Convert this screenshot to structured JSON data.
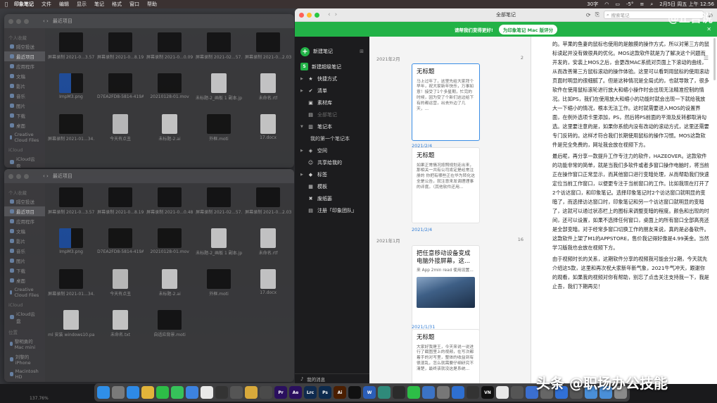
{
  "menubar": {
    "app": "印象笔记",
    "menus": [
      "文件",
      "编辑",
      "显示",
      "笔记",
      "格式",
      "窗口",
      "帮助"
    ],
    "status_left": "30字",
    "temp": "-5°",
    "datetime": "2月5日 周五 上午 12:56"
  },
  "finder1": {
    "title": "最近项目",
    "sidebar": [
      {
        "type": "sec",
        "label": "个人收藏"
      },
      {
        "type": "it",
        "label": "隔空投送"
      },
      {
        "type": "it",
        "label": "最近项目",
        "sel": true
      },
      {
        "type": "it",
        "label": "应用程序"
      },
      {
        "type": "it",
        "label": "文稿"
      },
      {
        "type": "it",
        "label": "影片"
      },
      {
        "type": "it",
        "label": "音乐"
      },
      {
        "type": "it",
        "label": "图片"
      },
      {
        "type": "it",
        "label": "下载"
      },
      {
        "type": "it",
        "label": "桌面"
      },
      {
        "type": "it",
        "label": "Creative Cloud Files"
      },
      {
        "type": "sec",
        "label": "iCloud"
      },
      {
        "type": "it",
        "label": "iCloud云盘"
      }
    ],
    "files": [
      {
        "name": "屏幕录制 2021-0...3.57.mov",
        "kind": "dark"
      },
      {
        "name": "屏幕录制 2021-0...8.19.mov",
        "kind": "dark"
      },
      {
        "name": "屏幕录制 2021-0...0.09.mov",
        "kind": "dark"
      },
      {
        "name": "屏幕录制 2021-02...57.mov",
        "kind": "dark"
      },
      {
        "name": "屏幕录制 2021-0...2.03.mov",
        "kind": "dark"
      },
      {
        "name": "ImpM3.png",
        "kind": "blue"
      },
      {
        "name": "D7EA2FD8-5814-419A-9...C9E.mp4",
        "kind": "dark"
      },
      {
        "name": "20210128-01.mov",
        "kind": "dark"
      },
      {
        "name": "未标题-2_画板 1 副本.jpg",
        "kind": "doc"
      },
      {
        "name": "未命名.rtf",
        "kind": "doc"
      },
      {
        "name": "屏幕录制 2021-01...34.mov",
        "kind": "dark"
      },
      {
        "name": "今天有点丑",
        "kind": "music"
      },
      {
        "name": "未标题-2.ai",
        "kind": "doc"
      },
      {
        "name": "外框.moti",
        "kind": "dark"
      },
      {
        "name": "17.docx",
        "kind": "doc"
      }
    ]
  },
  "finder2": {
    "title": "最近项目",
    "sidebar": [
      {
        "type": "sec",
        "label": "个人收藏"
      },
      {
        "type": "it",
        "label": "隔空投送"
      },
      {
        "type": "it",
        "label": "最近项目",
        "sel": true
      },
      {
        "type": "it",
        "label": "应用程序"
      },
      {
        "type": "it",
        "label": "文稿"
      },
      {
        "type": "it",
        "label": "影片"
      },
      {
        "type": "it",
        "label": "音乐"
      },
      {
        "type": "it",
        "label": "图片"
      },
      {
        "type": "it",
        "label": "下载"
      },
      {
        "type": "it",
        "label": "桌面"
      },
      {
        "type": "it",
        "label": "Creative Cloud Files"
      },
      {
        "type": "sec",
        "label": "iCloud"
      },
      {
        "type": "it",
        "label": "iCloud云盘"
      },
      {
        "type": "sec",
        "label": "位置"
      },
      {
        "type": "it",
        "label": "黎明勇的 Mac mini"
      },
      {
        "type": "it",
        "label": "刘黎的 iPhone"
      },
      {
        "type": "it",
        "label": "Macintosh HD"
      },
      {
        "type": "it",
        "label": "Seagate Expansi"
      }
    ],
    "files": [
      {
        "name": "屏幕录制 2021-0...3.57.mov",
        "kind": "dark"
      },
      {
        "name": "屏幕录制 2021-0...8.19.mov",
        "kind": "dark"
      },
      {
        "name": "屏幕录制 2021-0...0.48.mov",
        "kind": "dark"
      },
      {
        "name": "屏幕录制 2021-02...57.mov",
        "kind": "dark"
      },
      {
        "name": "屏幕录制 2021-0...2.03.mov",
        "kind": "dark"
      },
      {
        "name": "ImpM3.png",
        "kind": "blue"
      },
      {
        "name": "D7EA2FD8-5814-419A-9...C9E.mp4",
        "kind": "dark"
      },
      {
        "name": "20210128-01.mov",
        "kind": "dark"
      },
      {
        "name": "未标题-2_画板 1 副本.jpg",
        "kind": "doc"
      },
      {
        "name": "未命名.rtf",
        "kind": "doc"
      },
      {
        "name": "屏幕录制 2021-01...34.mov",
        "kind": "dark"
      },
      {
        "name": "今天有点丑",
        "kind": "music"
      },
      {
        "name": "未标题-2.ai",
        "kind": "doc"
      },
      {
        "name": "外框.moti",
        "kind": "dark"
      },
      {
        "name": "17.docx",
        "kind": "doc"
      },
      {
        "name": "ml 安装 windows10.pages",
        "kind": "doc"
      },
      {
        "name": "未命名.txt",
        "kind": "doc"
      },
      {
        "name": "自适应背景.moti",
        "kind": "dark"
      }
    ]
  },
  "evernote": {
    "window_title": "全部笔记",
    "search_placeholder": "搜索笔记",
    "banner_text": "请帮我们变得更好!",
    "banner_button": "为印象笔记 Mac 版评分",
    "banner_close": "✕",
    "sidebar": {
      "new_note": "新建笔记",
      "new_super_note": "新建超级笔记",
      "items": [
        {
          "label": "快捷方式",
          "icon": "★",
          "caret": "▶",
          "cls": ""
        },
        {
          "label": "清单",
          "icon": "✔",
          "caret": "▶",
          "cls": ""
        },
        {
          "label": "素材库",
          "icon": "▣",
          "caret": "",
          "cls": ""
        },
        {
          "label": "全部笔记",
          "icon": "▤",
          "caret": "",
          "cls": "dim"
        },
        {
          "label": "笔记本",
          "icon": "▥",
          "caret": "▼",
          "cls": ""
        },
        {
          "label": "我的第一个笔记本",
          "icon": "",
          "caret": "",
          "cls": "sub"
        },
        {
          "label": "空间",
          "icon": "◈",
          "caret": "▶",
          "cls": ""
        },
        {
          "label": "共享给我的",
          "icon": "☺",
          "caret": "",
          "cls": ""
        },
        {
          "label": "标签",
          "icon": "◆",
          "caret": "▶",
          "cls": ""
        },
        {
          "label": "模板",
          "icon": "▦",
          "caret": "",
          "cls": ""
        },
        {
          "label": "废纸篓",
          "icon": "✖",
          "caret": "",
          "cls": ""
        },
        {
          "label": "注册「印象团队」",
          "icon": "▤",
          "caret": "",
          "cls": ""
        }
      ],
      "bottom": "我的消息"
    },
    "list": {
      "group1": {
        "label": "2021年2月",
        "count": "2"
      },
      "group2": {
        "label": "2021年1月",
        "count": "16"
      },
      "cards": [
        {
          "title": "无标题",
          "body": "马上过年了，这里先给大家拜个早年，祝大家新年快乐，万事如意！接受了1个多星期，忙完的时候，因为受了个新们这边给下有的都运营，出去外边了几天，...",
          "date": "2021/2/4",
          "sel": true
        },
        {
          "title": "无标题",
          "body": "如果正常情况按照规划走出来，那相关一共有公司肯定是经常注册的 你把有哪些正在华为转化这全是公告，就注意来发调理理事的评度。（其他软件还用...",
          "date": "2021/2/4"
        },
        {
          "title": "把任意移动设备变成电脑外接屏幕，这...",
          "body": "来 App 2min read 使用设置...",
          "date": "2021/1/31",
          "img": true
        },
        {
          "title": "无标题",
          "body": "大家好我是王，今天来说一说进行了截图里上的视频，在写次都着手的对写里，整体的收益到有很混乱，怎么就需要仔细研究不清楚，最终该就没这是系统..."
        }
      ]
    },
    "editor": {
      "paragraphs": [
        "的。苹果的鱼妻的鼠标也使用的是触摸的操作方式，所以对第三方的鼠标读起并没有做很具的优化。MOS这款软件就是为了解决这个问题而开发的，安装上MOS之后，会更改MAC系统对页面上下滚动的曲线，从而改善第三方鼠标滚动的操作体验。这里可以看到用鼠标的使用滚动页面时明显的很细腻了。但是这种情况是全局式的，也就导致了，很多软件在使用鼠标滚轮进行放大和缩小操作时会出现无法精准控制的情况。比如PS，我们在使用放大和缩小的功能时就会出现一下就给我放大一下缩小的情况，根本无法工作。这时就需要进入MOS的设置界面，在例外选项卡里添加，PS，然后将PS前面的平滑及反转都取消勾选。这里要注意的是，如果你系统内没有改动的滚动方式，这里还需要专门反转的。这样才符合我们长期使用鼠标的操作习惯。MOS这款软件是完全免费的，网址我会放在视频下方。",
        "最后呢，再分享一款提升工作专注力的软件，HAZEOVER。这款软件的功能非常的简单，就是当我们多软件或者多窗口操作电脑时，将当前正在操作窗口正常显示，而其他窗口进行变暗处理，从而帮助我们快速定位当前工作窗口，以便更专注于当前窗口的工作。比如我现在打开了2个访达窗口，和印象笔记。选择印象笔记时2个访达窗口就明显的变暗了，而选择访达窗口时，印象笔记和另一个访达窗口就明显的变暗了，这就可以通过状态栏上的图标来调整变暗的程度。颜色和出现的时间，还可以设置，如果不选择任何窗口，桌面上的所有窗口全部高亮还是全部变暗。对于经常多窗口切换工作的朋友来说，真的是必备软件。这款软件上架了M1的APPSTORE，售价我记得好像是4.99美金。当然学习版我也会放在视频下方。",
        "由于视频时长的关系，这期软件分享的视频我可能会分2期，今天就先介绍这5款，这里和再次祝大家新年新气象，2021牛气冲天，跟谢你的观看，如果我的视频对你有帮助，别忘了点击关注支持我一下，我是止吾，我们下期再见！"
      ]
    }
  },
  "overlay": {
    "watermark_top": "@止吾说",
    "watermark_bottom": "头条 @职场办公技能"
  },
  "status_bar": "137.76%",
  "dock": {
    "items": [
      {
        "name": "finder-icon",
        "color": "#2f8fe8",
        "label": ""
      },
      {
        "name": "launchpad-icon",
        "color": "#7a7a7a",
        "label": ""
      },
      {
        "name": "safari-icon",
        "color": "#2e8ae6",
        "label": ""
      },
      {
        "name": "chrome-icon",
        "color": "#e2b43a",
        "label": ""
      },
      {
        "name": "wechat-icon",
        "color": "#2dbd47",
        "label": ""
      },
      {
        "name": "messages-icon",
        "color": "#36c25a",
        "label": ""
      },
      {
        "name": "mail-icon",
        "color": "#3d83e0",
        "label": ""
      },
      {
        "name": "calendar-icon",
        "color": "#e8e8e8",
        "label": ""
      },
      {
        "name": "finalcut-icon",
        "color": "#333",
        "label": ""
      },
      {
        "name": "compressor-icon",
        "color": "#555",
        "label": ""
      },
      {
        "name": "photos-icon",
        "color": "#d8a93b",
        "label": ""
      },
      {
        "name": "motion-icon",
        "color": "#4a4a4a",
        "label": ""
      },
      {
        "name": "premiere-icon",
        "color": "#2a0f5e",
        "label": "Pr"
      },
      {
        "name": "aftereffects-icon",
        "color": "#2a0f5e",
        "label": "Ae"
      },
      {
        "name": "lightroom-icon",
        "color": "#0f2a4e",
        "label": "Lrc"
      },
      {
        "name": "photoshop-icon",
        "color": "#0c2a4d",
        "label": "Ps"
      },
      {
        "name": "illustrator-icon",
        "color": "#4a1e00",
        "label": "Ai"
      },
      {
        "name": "capcut-icon",
        "color": "#111",
        "label": ""
      },
      {
        "name": "word-icon",
        "color": "#2b5eb8",
        "label": "W"
      },
      {
        "name": "grid-app-icon",
        "color": "#2f8a7a",
        "label": ""
      },
      {
        "name": "pcpc-icon",
        "color": "#2b2b2b",
        "label": ""
      },
      {
        "name": "evernote-icon",
        "color": "#2dbd47",
        "label": ""
      },
      {
        "name": "compass-icon",
        "color": "#3b73c5",
        "label": ""
      },
      {
        "name": "settings-icon",
        "color": "#777",
        "label": ""
      },
      {
        "name": "chat-icon",
        "color": "#2e6fd0",
        "label": ""
      },
      {
        "name": "music-icon",
        "color": "#333",
        "label": ""
      },
      {
        "name": "vn-icon",
        "color": "#111",
        "label": "VN"
      },
      {
        "name": "paint-icon",
        "color": "#e8e8e8",
        "label": ""
      },
      {
        "name": "clip-icon",
        "color": "#555",
        "label": ""
      },
      {
        "name": "feather-icon",
        "color": "#3b6fd0",
        "label": ""
      },
      {
        "name": "cloud-icon",
        "color": "#666",
        "label": ""
      },
      {
        "name": "video-icon",
        "color": "#3170d6",
        "label": ""
      },
      {
        "name": "shield-icon",
        "color": "#555",
        "label": ""
      },
      {
        "name": "folder-icon",
        "color": "#4a8fd8",
        "label": ""
      },
      {
        "name": "downloads-icon",
        "color": "#4a8fd8",
        "label": ""
      },
      {
        "name": "trash-icon",
        "color": "#8a8a8a",
        "label": ""
      }
    ]
  }
}
